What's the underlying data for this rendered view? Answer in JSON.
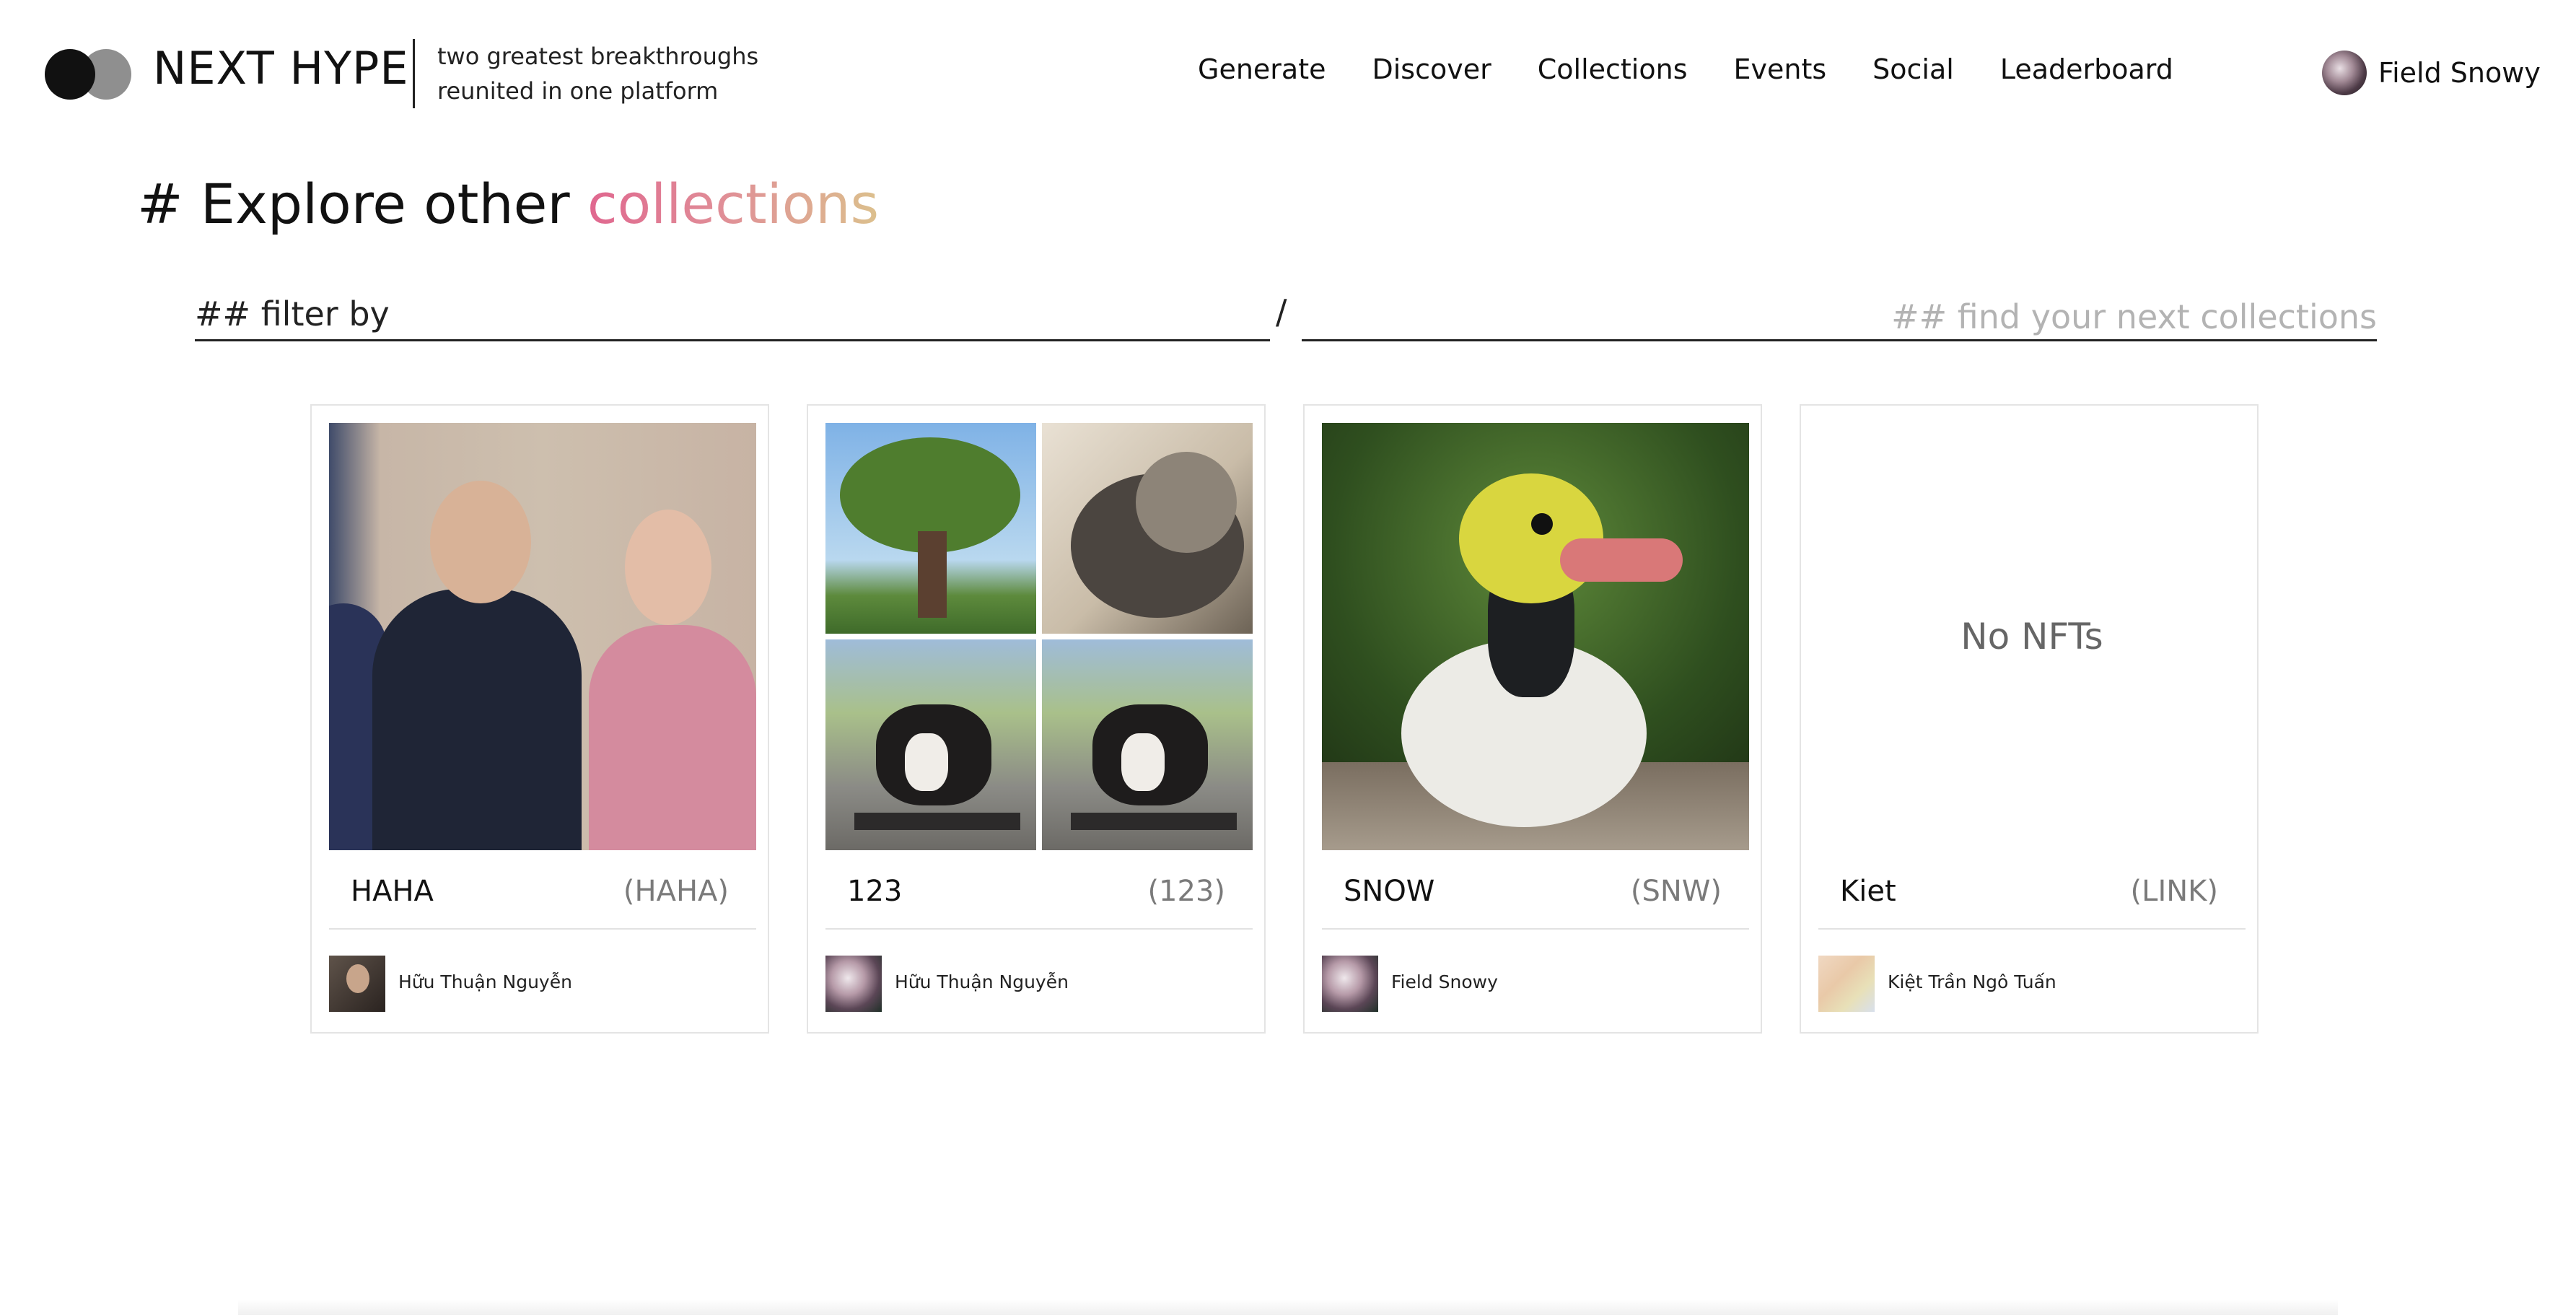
{
  "header": {
    "brand": "NEXT HYPE",
    "tagline_line1": "two greatest breakthroughs",
    "tagline_line2": "reunited in one platform",
    "nav": [
      "Generate",
      "Discover",
      "Collections",
      "Events",
      "Social",
      "Leaderboard"
    ],
    "user_name": "Field Snowy"
  },
  "page": {
    "title_prefix": "# Explore other ",
    "title_accent": "collections"
  },
  "filter": {
    "label": "## filter by",
    "separator": "/",
    "search_placeholder": "## find your next collections"
  },
  "collections": [
    {
      "name": "HAHA",
      "symbol": "(HAHA)",
      "owner": "Hữu Thuận Nguyễn",
      "thumb": "portrait-photo"
    },
    {
      "name": "123",
      "symbol": "(123)",
      "owner": "Hữu Thuận Nguyễn",
      "thumb": "four-image-grid"
    },
    {
      "name": "SNOW",
      "symbol": "(SNW)",
      "owner": "Field Snowy",
      "thumb": "duck-photo"
    },
    {
      "name": "Kiet",
      "symbol": "(LINK)",
      "owner": "Kiệt Trần Ngô Tuấn",
      "thumb": "empty",
      "empty_text": "No NFTs"
    }
  ]
}
